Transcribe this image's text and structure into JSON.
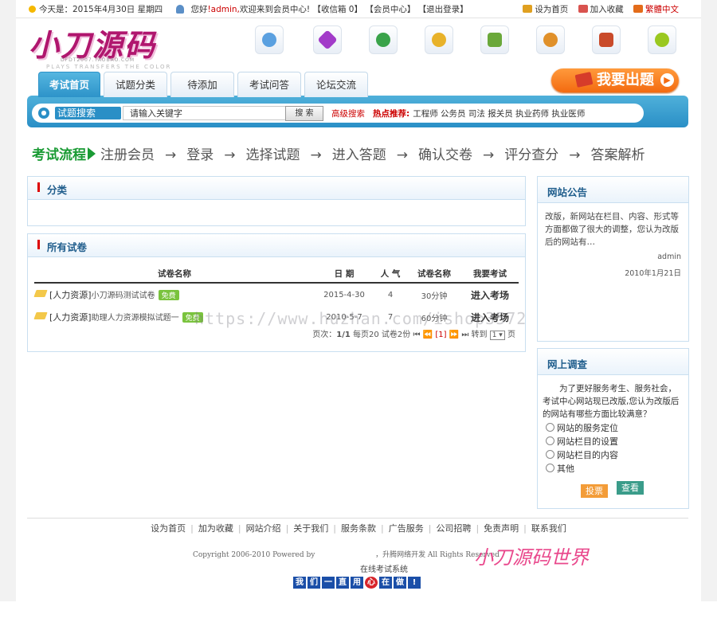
{
  "topbar": {
    "date_prefix": "今天是：",
    "date": "2015年4月30日",
    "weekday": "星期四",
    "greeting_pre": "您好",
    "username": "!admin,",
    "greeting_post": "欢迎来到会员中心!",
    "inbox": "【收信箱 0】",
    "member_center": "【会员中心】",
    "logout": "【退出登录】",
    "set_home": "设为首页",
    "add_fav": "加入收藏",
    "trad_chinese": "繁體中文"
  },
  "logo": {
    "title": "小刀源码",
    "sub1": "DFDT2007.TAOBAO.COM",
    "sub2": "PLAYS TRANSFERS THE COLOR"
  },
  "nav": {
    "tabs": [
      "考试首页",
      "试题分类",
      "待添加",
      "考试问答",
      "论坛交流"
    ],
    "active": 0,
    "cta": "我要出题"
  },
  "search": {
    "label": "试题搜索",
    "value": "请输入关键字",
    "button": "搜 索",
    "advanced": "高级搜索",
    "hot_label": "热点推荐:",
    "hot_items": "工程师 公务员 司法 报关员 执业药师 执业医师"
  },
  "flow": {
    "title": "考试流程",
    "steps": [
      "注册会员",
      "登录",
      "选择试题",
      "进入答题",
      "确认交卷",
      "评分查分",
      "答案解析"
    ]
  },
  "category_panel": {
    "title": "分类"
  },
  "papers_panel": {
    "title": "所有试卷",
    "columns": [
      "试卷名称",
      "日 期",
      "人 气",
      "试卷名称",
      "我要考试"
    ],
    "rows": [
      {
        "category": "[人力资源]",
        "name": "小刀源码测试试卷",
        "tag": "免费",
        "date": "2015-4-30",
        "views": "4",
        "duration": "30分钟",
        "action": "进入考场"
      },
      {
        "category": "[人力资源]",
        "name": "助理人力资源模拟试题一",
        "tag": "免费",
        "date": "2010-5-7",
        "views": "7",
        "duration": "60分钟",
        "action": "进入考场"
      }
    ],
    "pager": {
      "label": "页次：",
      "pages": "1/1",
      "per_page": "每页20",
      "total": "试卷2份",
      "current": "[1]",
      "goto": "转到",
      "select": "1",
      "unit": "页"
    }
  },
  "notice": {
    "title": "网站公告",
    "body": "改版，新网站在栏目、内容、形式等方面都做了很大的调整，您认为改版后的网站有…",
    "author": "admin",
    "date": "2010年1月21日"
  },
  "survey": {
    "title": "网上调查",
    "question": "为了更好服务考生、服务社会，考试中心网站现已改版,您认为改版后的网站有哪些方面比较满意？",
    "options": [
      "网站的服务定位",
      "网站栏目的设置",
      "网站栏目的内容",
      "其他"
    ],
    "vote": "投票",
    "view": "查看"
  },
  "footer": {
    "links": [
      "设为首页",
      "加为收藏",
      "网站介绍",
      "关于我们",
      "服务条款",
      "广告服务",
      "公司招聘",
      "免责声明",
      "联系我们"
    ],
    "copyright": "Copyright 2006-2010 Powered by",
    "developer": "，升腾网络开发 All Rights Reserved",
    "system_name": "在线考试系统",
    "slogan": [
      "我",
      "们",
      "一",
      "直",
      "用",
      "心",
      "在",
      "做",
      "!"
    ],
    "signature": "小刀源码世界"
  },
  "watermark": "https://www.huzhan.com/ishop3572",
  "colors": {
    "brand_blue": "#2a8fc6",
    "accent_orange": "#f36a10",
    "flow_green": "#1a9b34",
    "title_blue": "#1f5d8c"
  }
}
